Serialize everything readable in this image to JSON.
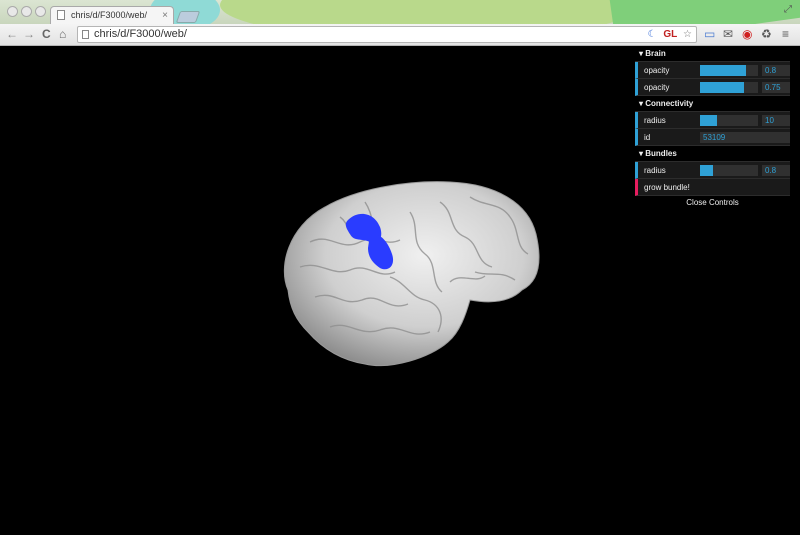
{
  "browser": {
    "tab_title": "chris/d/F3000/web/",
    "tab_close": "×",
    "url": "chris/d/F3000/web/",
    "omnibox_icons": {
      "moon": "☾",
      "gl": "GL",
      "star": "☆"
    },
    "nav": {
      "back": "←",
      "forward": "→",
      "reload": "C",
      "home": "⌂"
    },
    "extensions": {
      "ext1": "▭",
      "mail": "✉",
      "opera": "◉",
      "recycle": "♻",
      "menu": "≡"
    }
  },
  "gui": {
    "folders": [
      {
        "title": "Brain",
        "rows": [
          {
            "label": "opacity",
            "value": "0.8",
            "level": 0.8
          },
          {
            "label": "opacity",
            "value": "0.75",
            "level": 0.75
          }
        ]
      },
      {
        "title": "Connectivity",
        "rows": [
          {
            "label": "radius",
            "value": "10",
            "level": 0.3
          },
          {
            "label": "id",
            "value": "53109"
          }
        ]
      },
      {
        "title": "Bundles",
        "rows": [
          {
            "label": "radius",
            "value": "0.8",
            "level": 0.22
          },
          {
            "label": "grow bundle!"
          }
        ]
      }
    ],
    "close_label": "Close Controls",
    "accent": "#2fa1d6",
    "button_accent": "#e61d5f"
  },
  "scene": {
    "background": "#000000",
    "brain_color": "#c8c8c8",
    "bundle_color": "#2a3cff"
  }
}
